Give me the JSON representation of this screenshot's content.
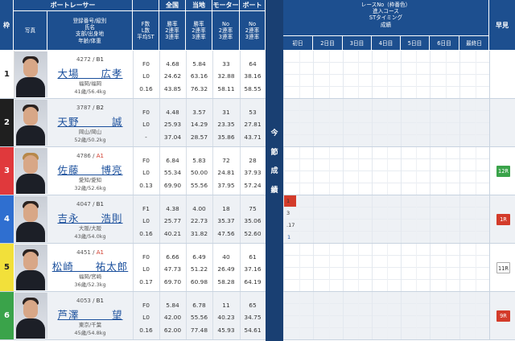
{
  "left_header": {
    "top": {
      "waku": "枠",
      "racer": "ボートレーサー",
      "zenkoku": "全国",
      "touchi": "当地",
      "motor": "モーター",
      "boat": "ボート"
    },
    "photo": "写真",
    "info_lines": [
      "登録番号/級別",
      "氏名",
      "支部/出身地",
      "年齢/体重"
    ],
    "f_lines": [
      "F数",
      "L数",
      "平均ST"
    ],
    "zenkoku_lines": [
      "勝率",
      "2連率",
      "3連率"
    ],
    "touchi_lines": [
      "勝率",
      "2連率",
      "3連率"
    ],
    "motor_lines": [
      "No",
      "2連率",
      "3連率"
    ],
    "boat_lines": [
      "No",
      "2連率",
      "3連率"
    ]
  },
  "band_title": [
    "今",
    "節",
    "成",
    "績"
  ],
  "right_header": {
    "lines": [
      "レースNo（枠番色）",
      "進入コース",
      "STタイミング",
      "成績"
    ],
    "days": [
      "初日",
      "2日目",
      "3日目",
      "4日目",
      "5日目",
      "6日目",
      "最終日"
    ],
    "pre": "早見"
  },
  "racers": [
    {
      "waku": "1",
      "reg": "4272 / ",
      "cls": "B1",
      "name": "大場　　広孝",
      "pref": "福岡/福岡",
      "age": "41歳/56.4kg",
      "f": "F0",
      "l": "L0",
      "st": "0.16",
      "zen": [
        "4.68",
        "24.62",
        "43.85"
      ],
      "tou": [
        "5.84",
        "63.16",
        "76.32"
      ],
      "mot": [
        "33",
        "32.88",
        "58.11"
      ],
      "boa": [
        "64",
        "38.16",
        "58.55"
      ]
    },
    {
      "waku": "2",
      "reg": "3787 / ",
      "cls": "B2",
      "name": "天野　　　誠",
      "pref": "岡山/岡山",
      "age": "52歳/50.2kg",
      "f": "F0",
      "l": "L0",
      "st": "-",
      "zen": [
        "4.48",
        "25.93",
        "37.04"
      ],
      "tou": [
        "3.57",
        "14.29",
        "28.57"
      ],
      "mot": [
        "31",
        "23.35",
        "35.86"
      ],
      "boa": [
        "53",
        "27.81",
        "43.71"
      ]
    },
    {
      "waku": "3",
      "reg": "4786 / ",
      "cls": "A1",
      "name": "佐藤　　博亮",
      "pref": "愛知/愛知",
      "age": "32歳/52.6kg",
      "f": "F0",
      "l": "L0",
      "st": "0.13",
      "zen": [
        "6.84",
        "55.34",
        "69.90"
      ],
      "tou": [
        "5.83",
        "50.00",
        "55.56"
      ],
      "mot": [
        "72",
        "24.81",
        "37.95"
      ],
      "boa": [
        "28",
        "37.93",
        "57.24"
      ]
    },
    {
      "waku": "4",
      "reg": "4047 / ",
      "cls": "B1",
      "name": "吉永　　浩則",
      "pref": "大阪/大阪",
      "age": "43歳/54.0kg",
      "f": "F1",
      "l": "L0",
      "st": "0.16",
      "zen": [
        "4.38",
        "25.77",
        "40.21"
      ],
      "tou": [
        "4.00",
        "22.73",
        "31.82"
      ],
      "mot": [
        "18",
        "35.37",
        "47.56"
      ],
      "boa": [
        "75",
        "35.06",
        "52.60"
      ]
    },
    {
      "waku": "5",
      "reg": "4451 / ",
      "cls": "A1",
      "name": "松崎　　祐太郎",
      "pref": "福岡/宮崎",
      "age": "36歳/52.3kg",
      "f": "F0",
      "l": "L0",
      "st": "0.17",
      "zen": [
        "6.66",
        "47.73",
        "69.70"
      ],
      "tou": [
        "6.49",
        "51.22",
        "60.98"
      ],
      "mot": [
        "40",
        "26.49",
        "58.28"
      ],
      "boa": [
        "61",
        "37.16",
        "64.19"
      ]
    },
    {
      "waku": "6",
      "reg": "4053 / ",
      "cls": "B1",
      "name": "芦澤　　　望",
      "pref": "東京/千葉",
      "age": "45歳/54.8kg",
      "f": "F0",
      "l": "L0",
      "st": "0.16",
      "zen": [
        "5.84",
        "42.00",
        "62.00"
      ],
      "tou": [
        "6.78",
        "55.56",
        "77.48"
      ],
      "mot": [
        "11",
        "40.23",
        "45.93"
      ],
      "boa": [
        "65",
        "34.75",
        "54.61"
      ]
    }
  ],
  "current_results": {
    "row4_day1": {
      "rank": "1",
      "course": "3",
      "st": ".17",
      "result": "1"
    }
  },
  "hayami": [
    {
      "row": 3,
      "label": "12R",
      "style": "green"
    },
    {
      "row": 4,
      "label": "1R",
      "style": "red"
    },
    {
      "row": 5,
      "label": "11R",
      "style": "white"
    },
    {
      "row": 6,
      "label": "9R",
      "style": "red"
    }
  ],
  "colors": {
    "header": "#1d4f8f",
    "band": "#193f72",
    "waku": [
      "#ffffff",
      "#1f1f1f",
      "#e0393c",
      "#2f6fd0",
      "#f2e03a",
      "#3aa34a"
    ],
    "waku_text": [
      "#222222",
      "#ffffff",
      "#ffffff",
      "#ffffff",
      "#222222",
      "#ffffff"
    ]
  }
}
